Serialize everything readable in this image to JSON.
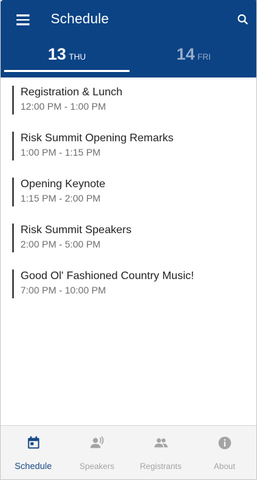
{
  "header": {
    "title": "Schedule",
    "menu_icon": "menu-icon",
    "search_icon": "search-icon",
    "bg_color": "#0b4385"
  },
  "tabs": [
    {
      "day": "13",
      "weekday": "THU",
      "selected": true
    },
    {
      "day": "14",
      "weekday": "FRI",
      "selected": false
    }
  ],
  "events": [
    {
      "name": "Registration & Lunch",
      "time": "12:00 PM - 1:00 PM"
    },
    {
      "name": "Risk Summit Opening Remarks",
      "time": "1:00 PM - 1:15 PM"
    },
    {
      "name": "Opening Keynote",
      "time": "1:15 PM - 2:00 PM"
    },
    {
      "name": "Risk Summit Speakers",
      "time": "2:00 PM - 5:00 PM"
    },
    {
      "name": "Good Ol' Fashioned Country Music!",
      "time": "7:00 PM - 10:00 PM"
    }
  ],
  "bottom_nav": {
    "items": [
      {
        "label": "Schedule",
        "icon": "calendar-icon",
        "active": true
      },
      {
        "label": "Speakers",
        "icon": "speakers-icon",
        "active": false
      },
      {
        "label": "Registrants",
        "icon": "people-icon",
        "active": false
      },
      {
        "label": "About",
        "icon": "info-icon",
        "active": false
      }
    ],
    "active_color": "#1a4b87",
    "inactive_color": "#a4a4a4"
  }
}
